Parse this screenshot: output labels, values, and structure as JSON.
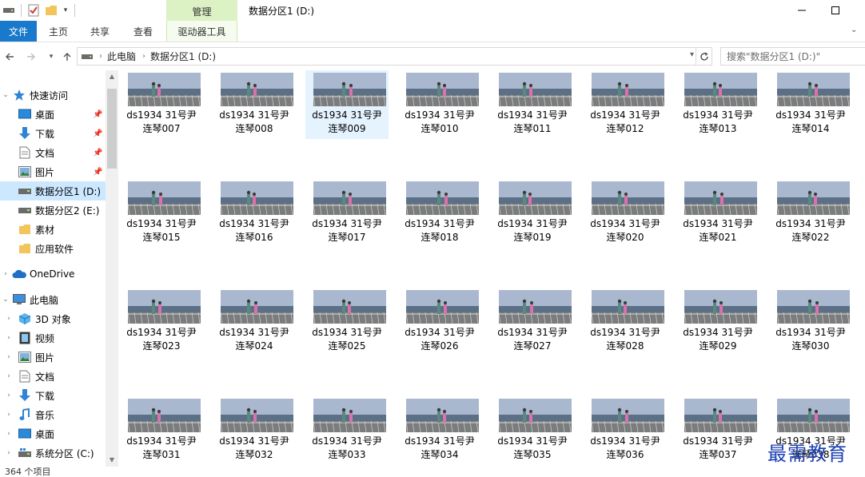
{
  "window": {
    "title": "数据分区1 (D:)",
    "context_tab": "管理",
    "context_tab_color": "#dcf1c4"
  },
  "ribbon": {
    "tabs": [
      "文件",
      "主页",
      "共享",
      "查看",
      "驱动器工具"
    ],
    "file_tab_color": "#1979ca"
  },
  "address": {
    "crumbs": [
      "此电脑",
      "数据分区1 (D:)"
    ]
  },
  "search": {
    "placeholder": "搜索\"数据分区1 (D:)\""
  },
  "nav": {
    "items": [
      {
        "label": "快速访问",
        "icon": "star-icon"
      },
      {
        "label": "桌面",
        "icon": "desktop-icon",
        "pinned": true
      },
      {
        "label": "下载",
        "icon": "download-icon",
        "pinned": true
      },
      {
        "label": "文档",
        "icon": "document-icon",
        "pinned": true
      },
      {
        "label": "图片",
        "icon": "picture-icon",
        "pinned": true
      },
      {
        "label": "数据分区1 (D:)",
        "icon": "drive-icon",
        "selected": true
      },
      {
        "label": "数据分区2 (E:)",
        "icon": "drive-icon"
      },
      {
        "label": "素材",
        "icon": "folder-icon"
      },
      {
        "label": "应用软件",
        "icon": "folder-icon"
      },
      {
        "label": "OneDrive",
        "icon": "cloud-icon"
      },
      {
        "label": "此电脑",
        "icon": "computer-icon"
      },
      {
        "label": "3D 对象",
        "icon": "cube-icon"
      },
      {
        "label": "视频",
        "icon": "video-icon"
      },
      {
        "label": "图片",
        "icon": "picture-icon"
      },
      {
        "label": "文档",
        "icon": "document-icon"
      },
      {
        "label": "下载",
        "icon": "download-icon"
      },
      {
        "label": "音乐",
        "icon": "music-icon"
      },
      {
        "label": "桌面",
        "icon": "desktop-icon"
      },
      {
        "label": "系统分区 (C:)",
        "icon": "system-drive-icon"
      }
    ]
  },
  "files": {
    "prefix": "ds1934 31号尹",
    "items": [
      "连琴007",
      "连琴008",
      "连琴009",
      "连琴010",
      "连琴011",
      "连琴012",
      "连琴013",
      "连琴014",
      "连琴015",
      "连琴016",
      "连琴017",
      "连琴018",
      "连琴019",
      "连琴020",
      "连琴021",
      "连琴022",
      "连琴023",
      "连琴024",
      "连琴025",
      "连琴026",
      "连琴027",
      "连琴028",
      "连琴029",
      "连琴030",
      "连琴031",
      "连琴032",
      "连琴033",
      "连琴034",
      "连琴035",
      "连琴036",
      "连琴037",
      "连琴038"
    ],
    "selected_index": 2
  },
  "status": {
    "count": "364 个项目"
  },
  "watermark": "最需教育"
}
